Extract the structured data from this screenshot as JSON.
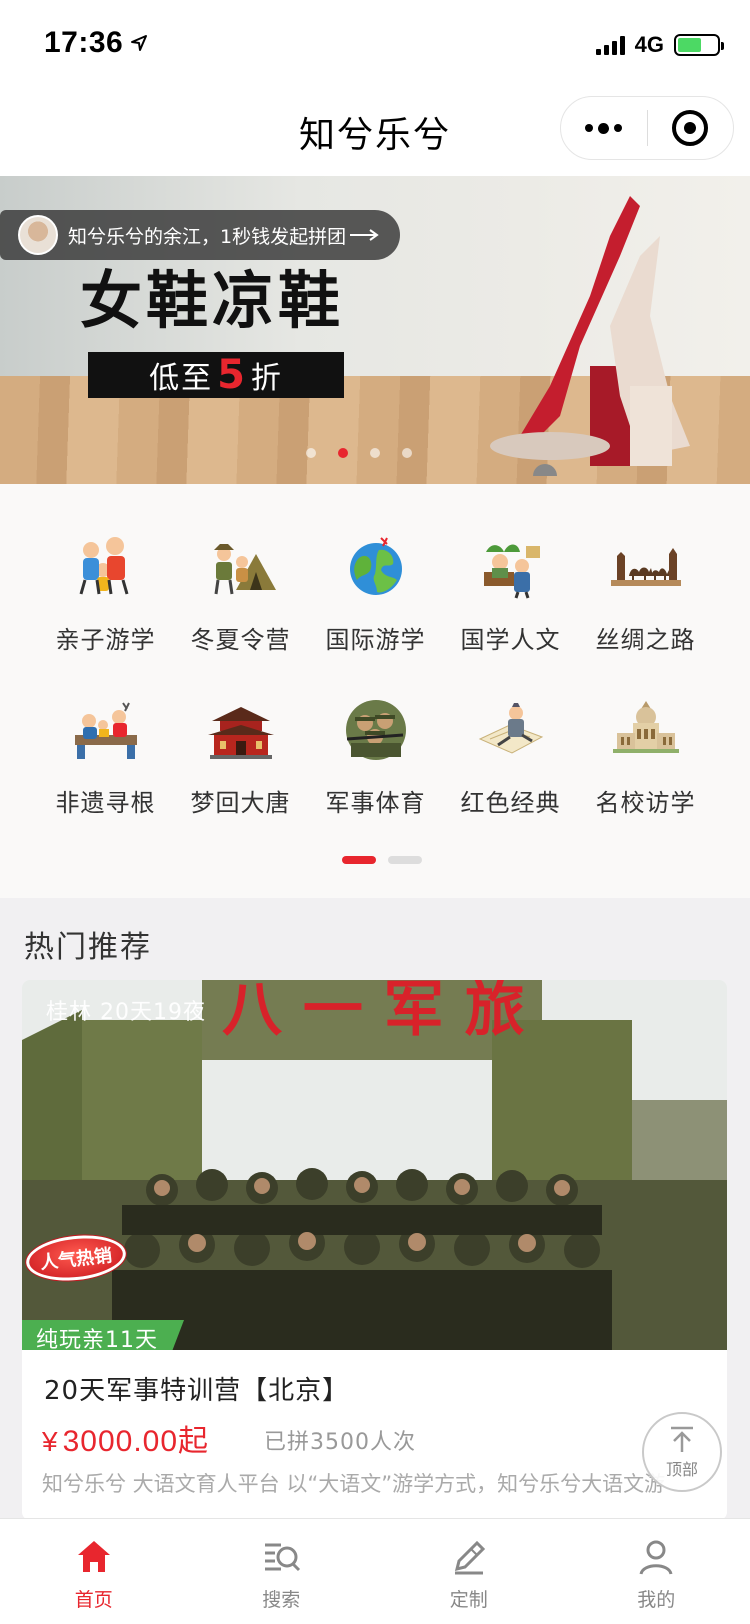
{
  "status_bar": {
    "time": "17:36",
    "network": "4G"
  },
  "nav": {
    "title": "知兮乐兮"
  },
  "banner": {
    "toast_text": "知兮乐兮的余江，1秒钱发起拼团",
    "heading": "女鞋凉鞋",
    "sub_prefix": "低至",
    "sub_number": "5",
    "sub_suffix": "折",
    "slide_count": 4,
    "active_slide": 2
  },
  "categories": [
    {
      "label": "亲子游学",
      "icon": "family-icon"
    },
    {
      "label": "冬夏令营",
      "icon": "tent-icon"
    },
    {
      "label": "国际游学",
      "icon": "globe-icon"
    },
    {
      "label": "国学人文",
      "icon": "scholar-icon"
    },
    {
      "label": "丝绸之路",
      "icon": "camel-caravan-icon"
    },
    {
      "label": "非遗寻根",
      "icon": "craft-icon"
    },
    {
      "label": "梦回大唐",
      "icon": "palace-icon"
    },
    {
      "label": "军事体育",
      "icon": "soldier-icon"
    },
    {
      "label": "红色经典",
      "icon": "map-figure-icon"
    },
    {
      "label": "名校访学",
      "icon": "university-icon"
    }
  ],
  "category_pager": {
    "pages": 2,
    "active": 1
  },
  "hot": {
    "title": "热门推荐",
    "card": {
      "location": "桂林  20天19夜",
      "sticker": "人气热销",
      "ribbon": "纯玩亲11天",
      "name": "20天军事特训营【北京】",
      "currency": "¥",
      "price": "3000.00起",
      "sold": "已拼3500人次",
      "desc": "知兮乐兮 大语文育人平台 以“大语文”游学方式，知兮乐兮大语文游"
    }
  },
  "back_to_top": "顶部",
  "tabs": [
    {
      "label": "首页",
      "icon": "home-icon",
      "active": true
    },
    {
      "label": "搜索",
      "icon": "search-icon",
      "active": false
    },
    {
      "label": "定制",
      "icon": "customize-icon",
      "active": false
    },
    {
      "label": "我的",
      "icon": "user-icon",
      "active": false
    }
  ],
  "colors": {
    "accent": "#e8262e",
    "ribbon": "#4caf50",
    "page_bg": "#f1f0f2"
  }
}
